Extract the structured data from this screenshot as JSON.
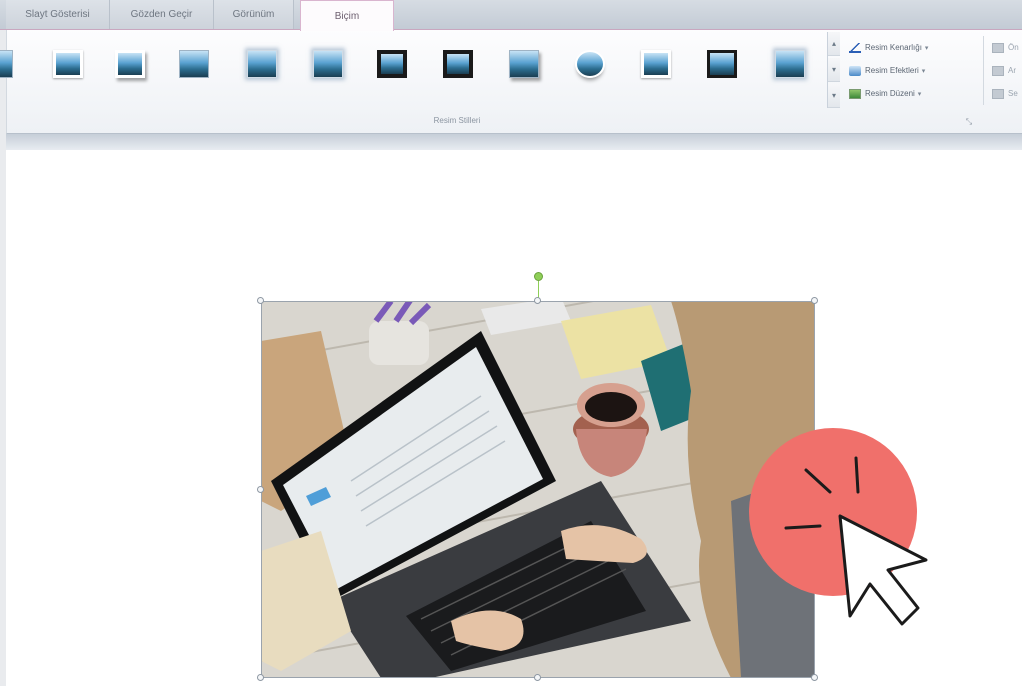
{
  "tabs": [
    {
      "label": "Slayt Gösterisi",
      "active": false
    },
    {
      "label": "Gözden Geçir",
      "active": false
    },
    {
      "label": "Görünüm",
      "active": false
    },
    {
      "label": "Biçim",
      "active": true
    }
  ],
  "ribbon": {
    "group_label": "Resim Stilleri",
    "launcher_glyph": "⤡",
    "picture_commands": [
      {
        "label": "Resim Kenarlığı",
        "icon": "picture-border-icon",
        "dropdown": "▾"
      },
      {
        "label": "Resim Efektleri",
        "icon": "picture-effects-icon",
        "dropdown": "▾"
      },
      {
        "label": "Resim Düzeni",
        "icon": "picture-layout-icon",
        "dropdown": "▾"
      }
    ],
    "arrange_commands": [
      {
        "label": "Ön",
        "icon": "bring-forward-icon"
      },
      {
        "label": "Ar",
        "icon": "send-backward-icon"
      },
      {
        "label": "Se",
        "icon": "selection-pane-icon"
      }
    ],
    "scroll_glyphs": [
      "▴",
      "▾",
      "▾"
    ]
  },
  "colors": {
    "accent_tab_border": "#d9b5cf",
    "click_badge": "#f0706b",
    "rotate_handle": "#8fcf58"
  },
  "icons": {
    "gallery_item": "picture-style-thumbnail-icon",
    "cursor": "mouse-pointer-icon",
    "click_badge": "click-indicator-icon"
  }
}
